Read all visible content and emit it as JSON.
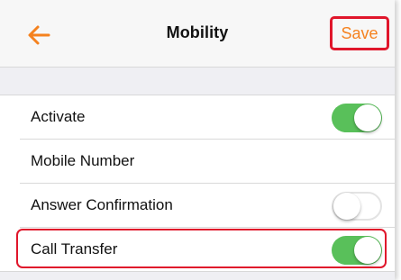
{
  "header": {
    "title": "Mobility",
    "save_label": "Save",
    "back_icon": "arrow-left-icon"
  },
  "colors": {
    "accent": "#f5821f",
    "toggle_on": "#59c05a",
    "highlight": "#e0162b"
  },
  "settings": [
    {
      "label": "Activate",
      "toggle": true
    },
    {
      "label": "Mobile Number"
    },
    {
      "label": "Answer Confirmation",
      "toggle": false
    },
    {
      "label": "Call Transfer",
      "toggle": true
    }
  ]
}
